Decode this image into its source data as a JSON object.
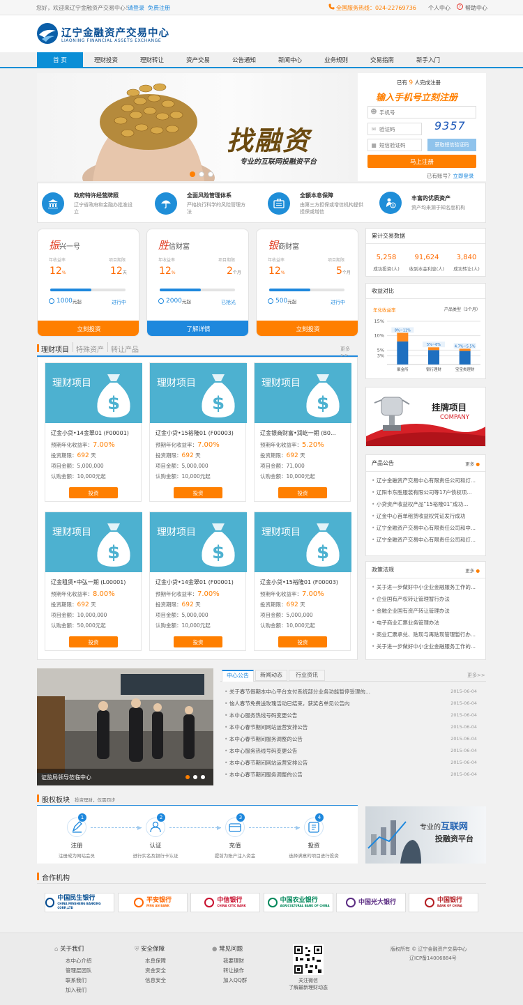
{
  "topbar": {
    "welcome": "您好，欢迎来辽宁金融资产交易中心！",
    "login": "请登录",
    "register": "免费注册",
    "hotline": "全国服务热线：024-22769736",
    "personal": "个人中心",
    "help": "帮助中心"
  },
  "brand": {
    "name_cn": "辽宁金融资产交易中心",
    "name_en": "LIAONING FINANCIAL ASSETS EXCHANGE"
  },
  "nav": [
    "首 页",
    "理财投资",
    "理财转让",
    "资产交易",
    "公告通知",
    "新闻中心",
    "业务规则",
    "交易指南",
    "新手入门"
  ],
  "banner": {
    "slogan_big": "找融资",
    "slogan_sub": "专业的互联网投融资平台"
  },
  "reg": {
    "registered_pre": "已有",
    "registered_count": "9",
    "registered_post": "人完成注册",
    "headline": "输入手机号立刻注册",
    "phone_ph": "手机号",
    "captcha_ph": "验证码",
    "captcha_code": "9357",
    "sms_ph": "短信验证码",
    "sms_btn": "获取短信验证码",
    "submit": "马上注册",
    "has_account": "已有账号？",
    "login_now": "立即登录"
  },
  "features": [
    {
      "title": "政府特许经营牌照",
      "desc": "辽宁省政府和金融办批准设立"
    },
    {
      "title": "全面风险管理体系",
      "desc": "严格执行科学的风险管理方法"
    },
    {
      "title": "全额本息保障",
      "desc": "由第三方担保或增信机构提供担保或增信"
    },
    {
      "title": "丰富的优质资产",
      "desc": "资产均来源于知名度机构"
    }
  ],
  "products": [
    {
      "first": "振",
      "rest": "兴一号",
      "rate_label": "年收益率",
      "period_label": "项目期限",
      "rate": "12",
      "rate_unit": "%",
      "period": "12",
      "period_unit": "天",
      "progress": 0.55,
      "min": "1000",
      "min_unit": "元起",
      "status": "进行中",
      "btn": "立刻投资",
      "btn_type": "orange"
    },
    {
      "first": "胜",
      "rest": "信财富",
      "rate_label": "年收益率",
      "period_label": "项目期限",
      "rate": "12",
      "rate_unit": "%",
      "period": "2",
      "period_unit": "个月",
      "progress": 0.55,
      "min": "2000",
      "min_unit": "元起",
      "status": "已抢光",
      "btn": "了解详情",
      "btn_type": "blue"
    },
    {
      "first": "银",
      "rest": "商财富",
      "rate_label": "年收益率",
      "period_label": "项目期限",
      "rate": "12",
      "rate_unit": "%",
      "period": "5",
      "period_unit": "个月",
      "progress": 0.55,
      "min": "500",
      "min_unit": "元起",
      "status": "进行中",
      "btn": "立刻投资",
      "btn_type": "orange"
    }
  ],
  "stats": {
    "title": "累计交易数据",
    "items": [
      {
        "value": "5,258",
        "label": "成功投资(人)"
      },
      {
        "value": "91,624",
        "label": "收到本金利息(人)"
      },
      {
        "value": "3,840",
        "label": "成功转让(人)"
      }
    ]
  },
  "compare": {
    "title": "收益对比",
    "left_label": "年化收益率",
    "right_label": "产品类型（3个月）"
  },
  "chart_data": {
    "type": "bar",
    "categories": [
      "聚金所",
      "银行理财",
      "宝宝类理财"
    ],
    "ylabel": "年化收益率",
    "y_ticks": [
      "15%",
      "10%",
      "5%",
      "3%"
    ],
    "data_labels": [
      "8%~11%",
      "5%~6%",
      "4.7%~5.5%"
    ],
    "series": [
      {
        "values": [
          8,
          5,
          4.7
        ]
      },
      {
        "values": [
          11,
          6,
          5.5
        ]
      }
    ]
  },
  "tabs": {
    "items": [
      "理财项目",
      "特殊资产",
      "转让产品"
    ],
    "more": "更多>>"
  },
  "projects": [
    {
      "img": "理财项目",
      "name": "辽金小贷•14金翠01 (F00001)",
      "rate_label": "预期年化收益率：",
      "rate": "7.00%",
      "period_label": "投资期限：",
      "period": "692",
      "period_unit": "天",
      "amount": "项目金额：5,000,000",
      "min": "认购金额：10,000元起",
      "btn": "投资"
    },
    {
      "img": "理财项目",
      "name": "辽金小贷•15裕隆01 (F00003)",
      "rate_label": "预期年化收益率：",
      "rate": "7.00%",
      "period_label": "投资期限：",
      "period": "692",
      "period_unit": "天",
      "amount": "项目金额：5,000,000",
      "min": "认购金额：10,000元起",
      "btn": "投资"
    },
    {
      "img": "理财项目",
      "name": "辽金银商财富•润屹一期 (B0...",
      "rate_label": "预期年化收益率：",
      "rate": "5.20%",
      "period_label": "投资期限：",
      "period": "692",
      "period_unit": "天",
      "amount": "项目金额：71,000",
      "min": "认购金额：10,000元起",
      "btn": "投资"
    },
    {
      "img": "理财项目",
      "name": "辽金租赁•中弘一期 (L00001)",
      "rate_label": "预期年化收益率：",
      "rate": "8.00%",
      "period_label": "投资期限：",
      "period": "692",
      "period_unit": "天",
      "amount": "项目金额：10,000,000",
      "min": "认购金额：50,000元起",
      "btn": "投资"
    },
    {
      "img": "理财项目",
      "name": "辽金小贷•14金翠01 (F00001)",
      "rate_label": "预期年化收益率：",
      "rate": "7.00%",
      "period_label": "投资期限：",
      "period": "692",
      "period_unit": "天",
      "amount": "项目金额：5,000,000",
      "min": "认购金额：10,000元起",
      "btn": "投资"
    },
    {
      "img": "理财项目",
      "name": "辽金小贷•15裕隆01 (F00003)",
      "rate_label": "预期年化收益率：",
      "rate": "7.00%",
      "period_label": "投资期限：",
      "period": "692",
      "period_unit": "天",
      "amount": "项目金额：5,000,000",
      "min": "认购金额：10,000元起",
      "btn": "投资"
    }
  ],
  "listing": {
    "title": "挂牌项目",
    "sub": "COMPANY"
  },
  "notice": {
    "title": "产品公告",
    "more": "更多",
    "items": [
      "辽宁金融资产交易中心有限责任公司和灯...",
      "辽阳市东胜服装有限公司等17户债权项...",
      "小贷资产收益权产品“15裕隆01”成功...",
      "辽金中心首单租赁收益权凭证发行成功",
      "辽宁金融资产交易中心有限责任公司和中...",
      "辽宁金融资产交易中心有限责任公司和灯..."
    ]
  },
  "policy": {
    "title": "政策法规",
    "more": "更多",
    "items": [
      "关于进一步做好中小企业金融服务工作的...",
      "企业国有产权转让管理暂行办法",
      "金融企业国有资产转让管理办法",
      "电子商业汇票业务管理办法",
      "商业汇票承兑、贴现与再贴现管理暂行办...",
      "关于进一步做好中小企业金融服务工作的..."
    ]
  },
  "photo": {
    "caption": "证监局领导莅临中心"
  },
  "news": {
    "tabs": [
      "中心公告",
      "新闻动态",
      "行业资讯"
    ],
    "more": "更多>>",
    "items": [
      {
        "t": "关于春节假期本中心平台支付系统部分业务功能暂停受理的...",
        "d": "2015-06-04"
      },
      {
        "t": "恼人春节免费送玫瑰活动已结束，获奖名单见公告内",
        "d": "2015-06-04"
      },
      {
        "t": "本中心服务热线号码变更公告",
        "d": "2015-06-04"
      },
      {
        "t": "本中心春节期间网站运营安排公告",
        "d": "2015-06-04"
      },
      {
        "t": "本中心春节期间服务调整的公告",
        "d": "2015-06-04"
      },
      {
        "t": "本中心服务热线号码变更公告",
        "d": "2015-06-04"
      },
      {
        "t": "本中心春节期间网站运营安排公告",
        "d": "2015-06-04"
      },
      {
        "t": "本中心春节期间服务调整的公告",
        "d": "2015-06-04"
      }
    ]
  },
  "equity": {
    "title": "股权板块",
    "sub": "投资理财，仅需四步",
    "steps": [
      {
        "n": "1",
        "t": "注册",
        "d": "注册成为网站会员"
      },
      {
        "n": "2",
        "t": "认证",
        "d": "进行实名及银行卡认证"
      },
      {
        "n": "3",
        "t": "充值",
        "d": "提前为账户注入资金"
      },
      {
        "n": "4",
        "t": "投资",
        "d": "选择满意的项目进行投资"
      }
    ],
    "banner_l1": "专业的",
    "banner_l2": "互联网",
    "banner_l3": "投融资平台"
  },
  "partners": {
    "title": "合作机构",
    "items": [
      {
        "name": "中国民生银行",
        "sub": "CHINA MINSHENG BANKING CORP.,LTD",
        "color": "#004a8f"
      },
      {
        "name": "平安银行",
        "sub": "PING AN BANK",
        "color": "#ff6600"
      },
      {
        "name": "中信银行",
        "sub": "CHINA CITIC BANK",
        "color": "#c8102e"
      },
      {
        "name": "中国农业银行",
        "sub": "AGRICULTURAL BANK OF CHINA",
        "color": "#00875a"
      },
      {
        "name": "中国光大银行",
        "sub": "",
        "color": "#5b2c83"
      },
      {
        "name": "中国银行",
        "sub": "BANK OF CHINA",
        "color": "#b41e23"
      }
    ]
  },
  "footer": {
    "cols": [
      {
        "h": "关于我们",
        "items": [
          "本中心介绍",
          "管理层团队",
          "联系我们",
          "加入我们"
        ]
      },
      {
        "h": "安全保障",
        "items": [
          "本息保障",
          "资金安全",
          "信息安全"
        ]
      },
      {
        "h": "常见问题",
        "items": [
          "我要理财",
          "转让操作",
          "加入QQ群"
        ]
      }
    ],
    "qr_l1": "关注微信",
    "qr_l2": "了解最新理财动态",
    "copyright": "版权所有 © 辽宁金融资产交易中心",
    "icp": "辽ICP备14006884号"
  }
}
